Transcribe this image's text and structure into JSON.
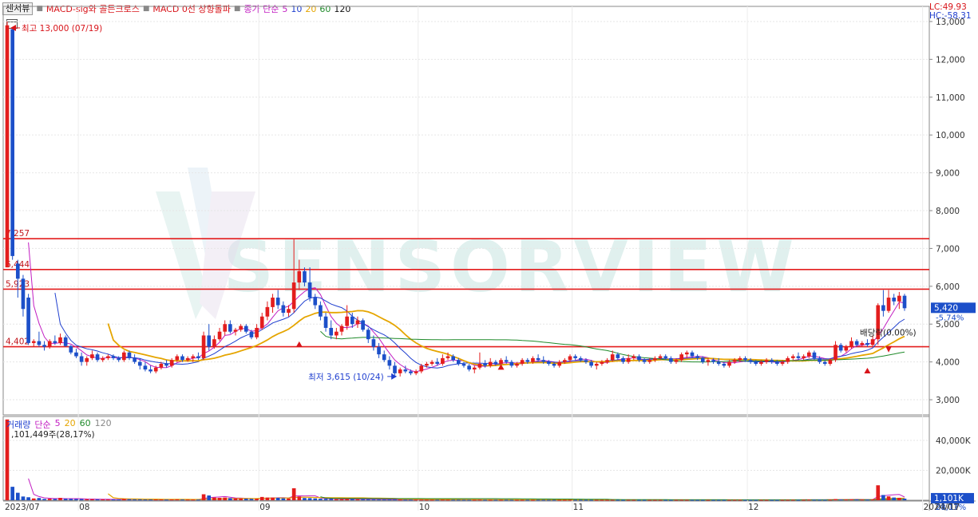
{
  "toolbar": {
    "sensorview_button": "센서뷰",
    "indicator_1": "MACD-sig와 골든크로스",
    "indicator_2": "MACD 0선 상향돌파",
    "ma_label": "종가 단순",
    "ma_periods": [
      "5",
      "10",
      "20",
      "60",
      "120"
    ]
  },
  "lc_hc": {
    "lc": "LC:49.93",
    "hc": "HC:-58.31"
  },
  "watermark": "SENSORVIEW",
  "colors": {
    "up": "#e31d1d",
    "down": "#1c4fc9",
    "ma5": "#c21ec2",
    "ma10": "#1f3fcf",
    "ma20": "#e5a500",
    "ma60": "#1f8a2a",
    "ma120": "#111111",
    "hline": "#e31d1d"
  },
  "annotations": {
    "high": "최고 13,000 (07/19)",
    "low": "최저 3,615 (10/24)",
    "dividend": "배당락(0.00%)",
    "current_price": "5,420",
    "current_change": "-5.74%"
  },
  "volume_panel": {
    "title": "거래량",
    "ma_label": "단순",
    "ma_periods": [
      "5",
      "20",
      "60",
      "120"
    ],
    "first_volume_label": ",101,449주(28,17%)",
    "current_volume": "1,101K",
    "current_volume_change": "28,17%"
  },
  "chart_data": {
    "type": "candlestick",
    "price_axis": {
      "min": 2600,
      "max": 13400,
      "ticks": [
        3000,
        4000,
        5000,
        6000,
        7000,
        8000,
        9000,
        10000,
        11000,
        12000,
        13000
      ],
      "tick_labels": [
        "3,000",
        "4,000",
        "5,000",
        "6,000",
        "7,000",
        "8,000",
        "9,000",
        "10,000",
        "11,000",
        "12,000",
        "13,000"
      ]
    },
    "volume_axis": {
      "min": 0,
      "max": 48000,
      "ticks": [
        20000,
        40000
      ],
      "tick_labels": [
        "20,000K",
        "40,000K"
      ]
    },
    "x_axis": {
      "labels": [
        "2023/07",
        "08",
        "09",
        "10",
        "11",
        "12",
        "2024/01",
        "01/17"
      ],
      "label_index": [
        0,
        14,
        48,
        78,
        107,
        140,
        173,
        196
      ]
    },
    "horizontal_levels": [
      {
        "label": "7,257",
        "value": 7257
      },
      {
        "label": "6,444",
        "value": 6444
      },
      {
        "label": "5,923",
        "value": 5923
      },
      {
        "label": "4,402",
        "value": 4402
      }
    ],
    "candles": [
      [
        6500,
        13000,
        6500,
        12900,
        54000
      ],
      [
        12800,
        12800,
        6700,
        6800,
        9000
      ],
      [
        6600,
        6700,
        5700,
        6200,
        5000
      ],
      [
        6200,
        6300,
        5200,
        5400,
        2500
      ],
      [
        5700,
        5800,
        4450,
        4500,
        2000
      ],
      [
        4500,
        4600,
        4400,
        4550,
        1200
      ],
      [
        4550,
        4800,
        4400,
        4450,
        1500
      ],
      [
        4450,
        4550,
        4300,
        4400,
        900
      ],
      [
        4400,
        4600,
        4350,
        4550,
        1000
      ],
      [
        4550,
        4700,
        4450,
        4500,
        900
      ],
      [
        4500,
        4750,
        4450,
        4650,
        1600
      ],
      [
        4650,
        4700,
        4400,
        4420,
        1000
      ],
      [
        4420,
        4450,
        4200,
        4250,
        900
      ],
      [
        4250,
        4350,
        4100,
        4150,
        800
      ],
      [
        4150,
        4250,
        3900,
        4000,
        800
      ],
      [
        4000,
        4150,
        3900,
        4100,
        700
      ],
      [
        4100,
        4300,
        4050,
        4200,
        700
      ],
      [
        4200,
        4250,
        4000,
        4050,
        600
      ],
      [
        4050,
        4150,
        4000,
        4100,
        600
      ],
      [
        4100,
        4200,
        4050,
        4150,
        500
      ],
      [
        4150,
        4200,
        4050,
        4100,
        500
      ],
      [
        4100,
        4150,
        4000,
        4050,
        500
      ],
      [
        4050,
        4300,
        4000,
        4250,
        900
      ],
      [
        4250,
        4300,
        4050,
        4100,
        700
      ],
      [
        4100,
        4200,
        3950,
        4000,
        600
      ],
      [
        4000,
        4100,
        3800,
        3900,
        600
      ],
      [
        3900,
        4000,
        3750,
        3800,
        500
      ],
      [
        3800,
        3900,
        3700,
        3750,
        500
      ],
      [
        3750,
        3900,
        3700,
        3850,
        500
      ],
      [
        3850,
        4000,
        3800,
        3950,
        500
      ],
      [
        3950,
        4050,
        3850,
        3900,
        450
      ],
      [
        3900,
        4100,
        3850,
        4050,
        500
      ],
      [
        4050,
        4200,
        4000,
        4150,
        600
      ],
      [
        4150,
        4200,
        4000,
        4050,
        500
      ],
      [
        4050,
        4150,
        4000,
        4100,
        450
      ],
      [
        4100,
        4200,
        4000,
        4150,
        450
      ],
      [
        4150,
        4250,
        4050,
        4100,
        450
      ],
      [
        4100,
        4800,
        4050,
        4700,
        4000
      ],
      [
        4700,
        5000,
        4300,
        4400,
        3200
      ],
      [
        4400,
        4700,
        4350,
        4600,
        1800
      ],
      [
        4600,
        4900,
        4550,
        4800,
        1600
      ],
      [
        4800,
        5100,
        4700,
        5000,
        1800
      ],
      [
        5000,
        5100,
        4750,
        4800,
        1400
      ],
      [
        4800,
        4900,
        4700,
        4850,
        1200
      ],
      [
        4850,
        5000,
        4800,
        4950,
        1100
      ],
      [
        4950,
        5000,
        4750,
        4800,
        1000
      ],
      [
        4800,
        4850,
        4600,
        4650,
        900
      ],
      [
        4650,
        5000,
        4600,
        4900,
        1000
      ],
      [
        4900,
        5300,
        4850,
        5200,
        2200
      ],
      [
        5200,
        5600,
        5100,
        5450,
        1800
      ],
      [
        5450,
        5800,
        5300,
        5700,
        1800
      ],
      [
        5700,
        5900,
        5400,
        5500,
        1600
      ],
      [
        5500,
        5600,
        5200,
        5300,
        1300
      ],
      [
        5300,
        5500,
        5200,
        5400,
        1200
      ],
      [
        5400,
        7250,
        5300,
        6100,
        8000
      ],
      [
        6100,
        6700,
        5900,
        6400,
        2500
      ],
      [
        6400,
        6500,
        6000,
        6100,
        1500
      ],
      [
        6100,
        6500,
        5600,
        5700,
        1400
      ],
      [
        5700,
        5800,
        5400,
        5500,
        1200
      ],
      [
        5500,
        5600,
        5100,
        5200,
        1000
      ],
      [
        5200,
        5300,
        4800,
        4900,
        900
      ],
      [
        4900,
        5100,
        4600,
        4700,
        800
      ],
      [
        4700,
        4900,
        4600,
        4800,
        700
      ],
      [
        4800,
        5000,
        4700,
        4950,
        700
      ],
      [
        4950,
        5500,
        4850,
        5200,
        900
      ],
      [
        5200,
        5300,
        4900,
        5000,
        800
      ],
      [
        5000,
        5200,
        4900,
        5100,
        700
      ],
      [
        5100,
        5150,
        4800,
        4850,
        700
      ],
      [
        4850,
        4900,
        4500,
        4600,
        600
      ],
      [
        4600,
        4700,
        4300,
        4400,
        600
      ],
      [
        4400,
        4500,
        4100,
        4200,
        500
      ],
      [
        4200,
        4300,
        4000,
        4050,
        500
      ],
      [
        4050,
        4150,
        3800,
        3900,
        500
      ],
      [
        3900,
        4000,
        3650,
        3700,
        500
      ],
      [
        3700,
        3850,
        3615,
        3800,
        450
      ],
      [
        3800,
        3900,
        3700,
        3750,
        400
      ],
      [
        3750,
        3800,
        3650,
        3700,
        400
      ],
      [
        3700,
        3800,
        3650,
        3750,
        400
      ],
      [
        3750,
        3950,
        3700,
        3900,
        400
      ],
      [
        3900,
        4000,
        3850,
        3950,
        350
      ],
      [
        3950,
        4050,
        3900,
        4000,
        350
      ],
      [
        4000,
        4100,
        3900,
        3950,
        350
      ],
      [
        3950,
        4200,
        3900,
        4100,
        400
      ],
      [
        4100,
        4250,
        4050,
        4150,
        350
      ],
      [
        4150,
        4200,
        4000,
        4050,
        350
      ],
      [
        4050,
        4100,
        3900,
        3950,
        350
      ],
      [
        3950,
        4000,
        3850,
        3900,
        300
      ],
      [
        3900,
        3950,
        3750,
        3800,
        300
      ],
      [
        3800,
        3900,
        3700,
        3850,
        300
      ],
      [
        3850,
        4250,
        3800,
        3950,
        400
      ],
      [
        3950,
        4050,
        3850,
        3900,
        300
      ],
      [
        3900,
        4100,
        3850,
        4000,
        300
      ],
      [
        4000,
        4050,
        3900,
        3950,
        300
      ],
      [
        3950,
        4100,
        3900,
        4050,
        300
      ],
      [
        4050,
        4150,
        3950,
        4000,
        300
      ],
      [
        4000,
        4050,
        3850,
        3900,
        280
      ],
      [
        3900,
        4000,
        3850,
        3950,
        280
      ],
      [
        3950,
        4100,
        3900,
        4050,
        280
      ],
      [
        4050,
        4100,
        3950,
        4000,
        280
      ],
      [
        4000,
        4150,
        3950,
        4100,
        280
      ],
      [
        4100,
        4200,
        4000,
        4050,
        280
      ],
      [
        4050,
        4150,
        3950,
        4000,
        260
      ],
      [
        4000,
        4050,
        3900,
        3950,
        260
      ],
      [
        3950,
        4000,
        3850,
        3900,
        260
      ],
      [
        3900,
        4050,
        3850,
        4000,
        260
      ],
      [
        4000,
        4100,
        3950,
        4050,
        260
      ],
      [
        4050,
        4200,
        4000,
        4150,
        300
      ],
      [
        4150,
        4200,
        4050,
        4100,
        280
      ],
      [
        4100,
        4150,
        4000,
        4050,
        260
      ],
      [
        4050,
        4100,
        3950,
        4000,
        260
      ],
      [
        4000,
        4050,
        3850,
        3900,
        260
      ],
      [
        3900,
        4000,
        3800,
        3950,
        260
      ],
      [
        3950,
        4050,
        3900,
        4000,
        260
      ],
      [
        4000,
        4100,
        3950,
        4050,
        260
      ],
      [
        4050,
        4300,
        4000,
        4200,
        300
      ],
      [
        4200,
        4250,
        4050,
        4100,
        280
      ],
      [
        4100,
        4150,
        3950,
        4000,
        260
      ],
      [
        4000,
        4200,
        3950,
        4100,
        300
      ],
      [
        4100,
        4200,
        4050,
        4150,
        280
      ],
      [
        4150,
        4200,
        4000,
        4050,
        260
      ],
      [
        4050,
        4100,
        3950,
        4000,
        260
      ],
      [
        4000,
        4100,
        3950,
        4050,
        260
      ],
      [
        4050,
        4150,
        4000,
        4100,
        260
      ],
      [
        4100,
        4200,
        4050,
        4150,
        280
      ],
      [
        4150,
        4200,
        4050,
        4100,
        260
      ],
      [
        4100,
        4150,
        3950,
        4000,
        260
      ],
      [
        4000,
        4100,
        3950,
        4050,
        280
      ],
      [
        4050,
        4250,
        4000,
        4200,
        320
      ],
      [
        4200,
        4300,
        4100,
        4250,
        300
      ],
      [
        4250,
        4300,
        4100,
        4150,
        280
      ],
      [
        4150,
        4200,
        4050,
        4100,
        260
      ],
      [
        4100,
        4150,
        3950,
        4000,
        260
      ],
      [
        4000,
        4100,
        3900,
        4050,
        260
      ],
      [
        4050,
        4100,
        3950,
        4000,
        260
      ],
      [
        4000,
        4100,
        3900,
        3950,
        260
      ],
      [
        3950,
        4000,
        3850,
        3900,
        260
      ],
      [
        3900,
        4050,
        3850,
        4000,
        280
      ],
      [
        4000,
        4100,
        3950,
        4050,
        280
      ],
      [
        4050,
        4150,
        4000,
        4100,
        300
      ],
      [
        4100,
        4150,
        4000,
        4050,
        280
      ],
      [
        4050,
        4100,
        3950,
        4000,
        260
      ],
      [
        4000,
        4050,
        3900,
        3950,
        260
      ],
      [
        3950,
        4050,
        3900,
        4000,
        260
      ],
      [
        4000,
        4100,
        3950,
        4050,
        260
      ],
      [
        4050,
        4100,
        3950,
        4000,
        260
      ],
      [
        4000,
        4050,
        3900,
        3950,
        260
      ],
      [
        3950,
        4050,
        3900,
        4000,
        260
      ],
      [
        4000,
        4150,
        3950,
        4100,
        300
      ],
      [
        4100,
        4200,
        4050,
        4150,
        320
      ],
      [
        4150,
        4250,
        4050,
        4100,
        300
      ],
      [
        4100,
        4200,
        4050,
        4150,
        300
      ],
      [
        4150,
        4300,
        4100,
        4250,
        400
      ],
      [
        4250,
        4300,
        4050,
        4100,
        350
      ],
      [
        4100,
        4150,
        3950,
        4000,
        350
      ],
      [
        4000,
        4050,
        3900,
        3950,
        320
      ],
      [
        3950,
        4100,
        3900,
        4050,
        350
      ],
      [
        4050,
        4550,
        4000,
        4450,
        800
      ],
      [
        4450,
        4500,
        4250,
        4300,
        500
      ],
      [
        4300,
        4450,
        4250,
        4400,
        500
      ],
      [
        4400,
        4650,
        4350,
        4550,
        600
      ],
      [
        4550,
        4600,
        4400,
        4450,
        500
      ],
      [
        4450,
        4550,
        4400,
        4500,
        450
      ],
      [
        4500,
        4600,
        4400,
        4450,
        450
      ],
      [
        4450,
        4700,
        4400,
        4600,
        500
      ],
      [
        4600,
        5550,
        4450,
        5500,
        10000
      ],
      [
        5500,
        5900,
        5200,
        5350,
        3500
      ],
      [
        5350,
        5900,
        5300,
        5700,
        2600
      ],
      [
        5700,
        5800,
        5500,
        5600,
        1800
      ],
      [
        5600,
        5850,
        5400,
        5750,
        1600
      ],
      [
        5750,
        5800,
        5350,
        5420,
        1101
      ]
    ]
  }
}
